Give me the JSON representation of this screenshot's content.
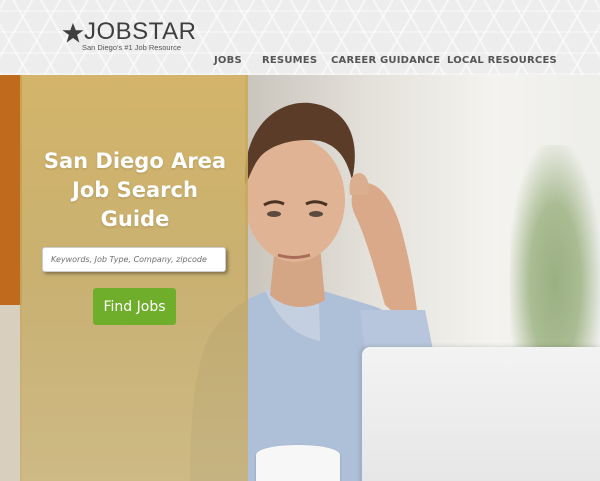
{
  "logo": {
    "wordmark": "JOBSTAR",
    "tagline": "San Diego's #1 Job Resource",
    "icon": "star-icon"
  },
  "nav": {
    "items": [
      {
        "label": "JOBS"
      },
      {
        "label": "RESUMES"
      },
      {
        "label": "CAREER GUIDANCE"
      },
      {
        "label": "LOCAL RESOURCES"
      }
    ]
  },
  "hero": {
    "title": "San Diego Area Job Search Guide",
    "search_placeholder": "Keywords, Job Type, Company, zipcode",
    "search_value": "",
    "button_label": "Find Jobs"
  },
  "colors": {
    "accent_green": "#6fae2b",
    "overlay_gold": "#cdaa55",
    "nav_text": "#555555",
    "header_bg": "#ededed"
  }
}
